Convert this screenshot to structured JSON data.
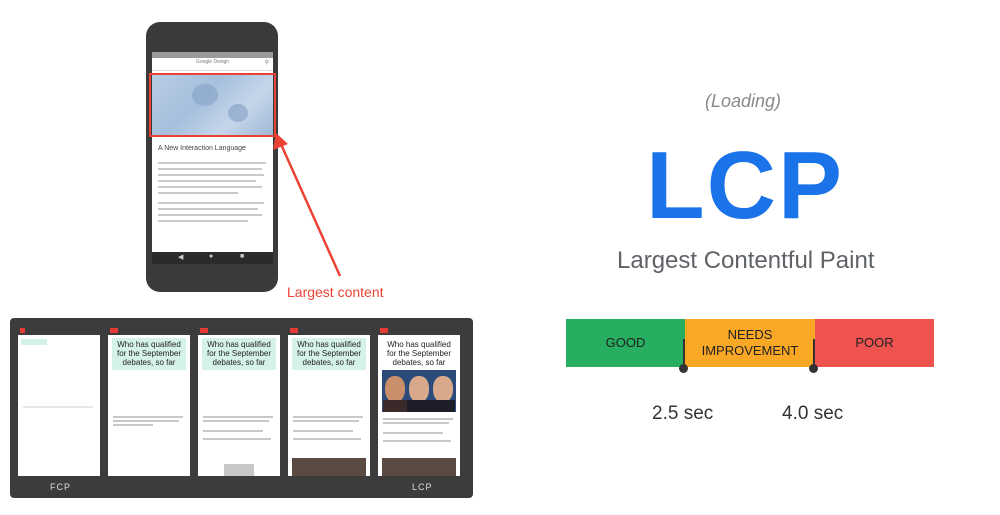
{
  "phone": {
    "app_title": "Google Design",
    "article_title": "A New Interaction Language",
    "annotation": "Largest content"
  },
  "filmstrip": {
    "headline": "Who has qualified for the September debates, so far",
    "fcp_label": "FCP",
    "lcp_label": "LCP"
  },
  "metric": {
    "loading_label": "(Loading)",
    "acronym": "LCP",
    "full_name": "Largest Contentful Paint"
  },
  "scale": {
    "segments": [
      {
        "label": "GOOD",
        "color": "#27ae60"
      },
      {
        "label": "NEEDS IMPROVEMENT",
        "color": "#f9a825"
      },
      {
        "label": "POOR",
        "color": "#ef5350"
      }
    ],
    "thresholds": [
      "2.5 sec",
      "4.0 sec"
    ]
  },
  "colors": {
    "accent_blue": "#1a73e8",
    "highlight_red": "#ea4335"
  }
}
